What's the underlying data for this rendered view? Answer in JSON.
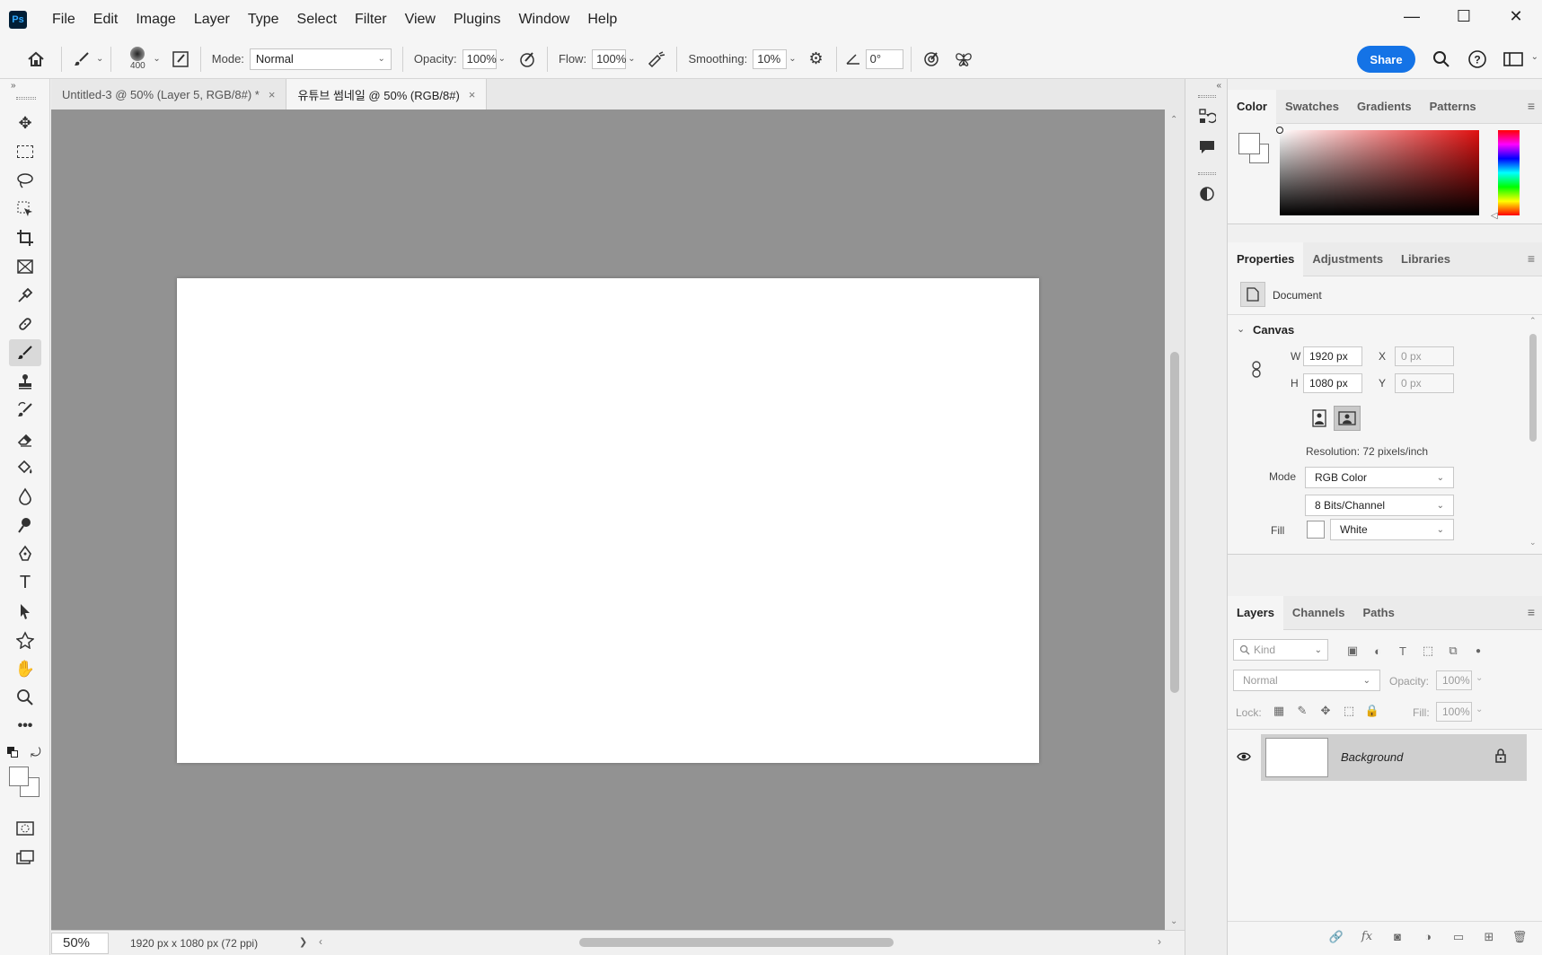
{
  "app": {
    "logo": "Ps"
  },
  "menu": [
    "File",
    "Edit",
    "Image",
    "Layer",
    "Type",
    "Select",
    "Filter",
    "View",
    "Plugins",
    "Window",
    "Help"
  ],
  "window_controls": {
    "minimize": "—",
    "maximize": "☐",
    "close": "✕"
  },
  "options": {
    "brush_size": "400",
    "mode_label": "Mode:",
    "mode_value": "Normal",
    "opacity_label": "Opacity:",
    "opacity_value": "100%",
    "flow_label": "Flow:",
    "flow_value": "100%",
    "smoothing_label": "Smoothing:",
    "smoothing_value": "10%",
    "angle_value": "0°",
    "share_label": "Share"
  },
  "tabs": [
    {
      "label": "Untitled-3 @ 50% (Layer 5, RGB/8#) *",
      "close": "×"
    },
    {
      "label": "유튜브 썸네일 @ 50% (RGB/8#)",
      "close": "×"
    }
  ],
  "status": {
    "zoom": "50%",
    "doc_info": "1920 px x 1080 px (72 ppi)",
    "arrow": "❯"
  },
  "color_panel": {
    "tabs": [
      "Color",
      "Swatches",
      "Gradients",
      "Patterns"
    ],
    "menu_icon": "≡"
  },
  "properties_panel": {
    "tabs": [
      "Properties",
      "Adjustments",
      "Libraries"
    ],
    "menu_icon": "≡",
    "doc_label": "Document",
    "section": "Canvas",
    "w_label": "W",
    "w_value": "1920 px",
    "h_label": "H",
    "h_value": "1080 px",
    "x_label": "X",
    "x_value": "0 px",
    "y_label": "Y",
    "y_value": "0 px",
    "resolution": "Resolution: 72 pixels/inch",
    "mode_label": "Mode",
    "mode_value": "RGB Color",
    "bits_value": "8 Bits/Channel",
    "fill_label": "Fill",
    "fill_value": "White"
  },
  "layers_panel": {
    "tabs": [
      "Layers",
      "Channels",
      "Paths"
    ],
    "menu_icon": "≡",
    "kind_placeholder": "Kind",
    "blend_mode": "Normal",
    "opacity_label": "Opacity:",
    "opacity_value": "100%",
    "lock_label": "Lock:",
    "fill_label": "Fill:",
    "fill_value": "100%",
    "layers": [
      {
        "name": "Background",
        "visible": true,
        "locked": true
      }
    ]
  },
  "colors": {
    "accent": "#1473e6",
    "canvas_bg": "#929292",
    "artboard": "#ffffff"
  }
}
